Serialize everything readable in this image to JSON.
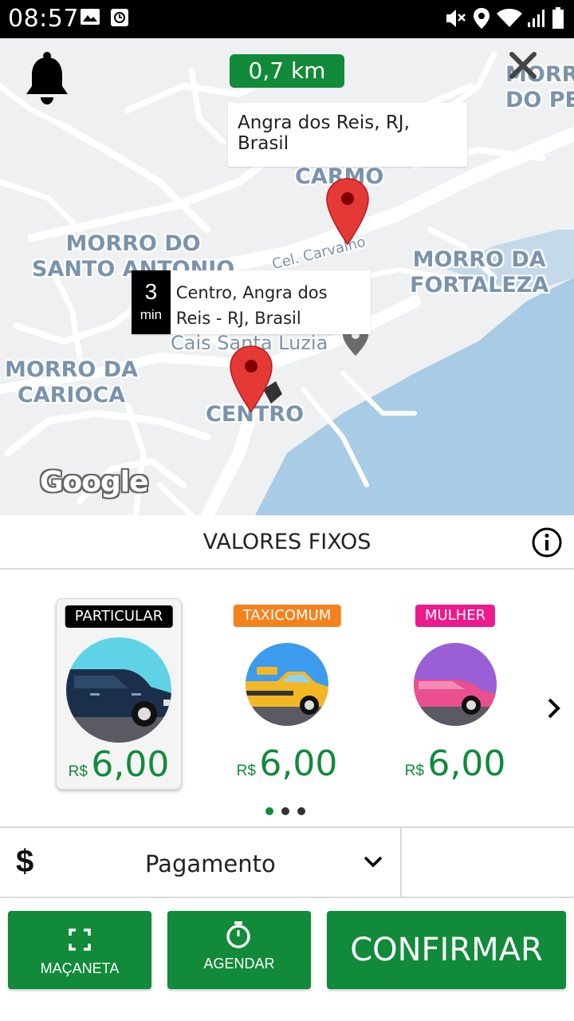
{
  "status_bar": {
    "time": "08:57",
    "left_icons": [
      "image-icon",
      "clock-app-icon"
    ],
    "right_icons": [
      "mute-icon",
      "location-icon",
      "wifi-icon",
      "signal-icon",
      "battery-icon"
    ]
  },
  "map": {
    "distance": "0,7 km",
    "destination_address": "Angra dos Reis, RJ, Brasil",
    "origin_eta_value": "3",
    "origin_eta_unit": "min",
    "origin_address": "Centro, Angra dos Reis - RJ, Brasil",
    "labels": {
      "carmo": "CARMO",
      "morro_do_peri": "MORRO\nDO PERI",
      "morro_santo_antonio": "MORRO DO\nSANTO ANTONIO",
      "morro_fortaleza": "MORRO DA\nFORTALEZA",
      "morro_carioca": "MORRO DA\nCARIOCA",
      "cais": "Cais Santa Luzia",
      "centro": "CENTRO",
      "street": "Cel. Carvalho"
    },
    "attribution": "Google",
    "colors": {
      "land": "#eef0f2",
      "water": "#a8cbe6",
      "road": "#ffffff",
      "pin": "#e53935"
    }
  },
  "values_section": {
    "title": "VALORES FIXOS"
  },
  "categories": [
    {
      "tag": "PARTICULAR",
      "tag_color": "#000000",
      "currency": "R$",
      "price": "6,00",
      "selected": true,
      "icon": "dark-car-icon"
    },
    {
      "tag": "TAXICOMUM",
      "tag_color": "#f5821f",
      "currency": "R$",
      "price": "6,00",
      "selected": false,
      "icon": "taxi-icon"
    },
    {
      "tag": "MULHER",
      "tag_color": "#ec1a8c",
      "currency": "R$",
      "price": "6,00",
      "selected": false,
      "icon": "pink-car-icon"
    }
  ],
  "pager": {
    "pages": 3,
    "active": 1
  },
  "payment": {
    "symbol": "$",
    "label": "Pagamento"
  },
  "actions": {
    "macaneta": "MAÇANETA",
    "agendar": "AGENDAR",
    "confirmar": "CONFIRMAR"
  },
  "brand_color": "#118a3a"
}
